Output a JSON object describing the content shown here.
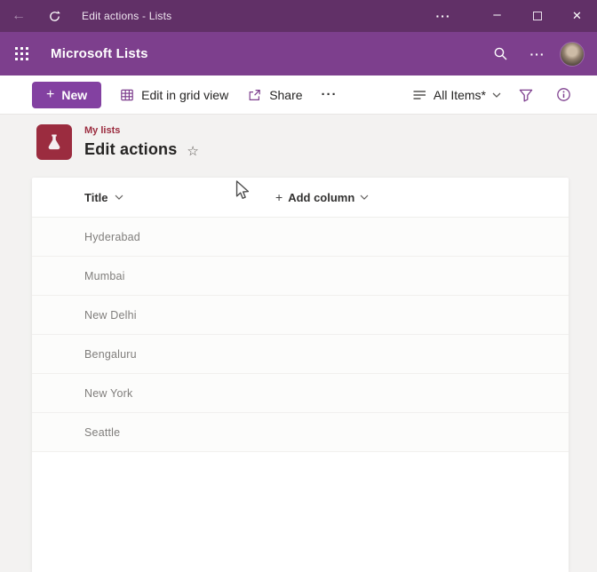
{
  "window": {
    "title": "Edit actions - Lists"
  },
  "app_header": {
    "app_name": "Microsoft Lists"
  },
  "toolbar": {
    "new_label": "New",
    "edit_grid_label": "Edit in grid view",
    "share_label": "Share",
    "view_selected": "All Items*"
  },
  "list_header": {
    "breadcrumb": "My lists",
    "title": "Edit actions"
  },
  "table": {
    "columns": [
      "Title"
    ],
    "add_column_label": "Add column",
    "rows": [
      "Hyderabad",
      "Mumbai",
      "New Delhi",
      "Bengaluru",
      "New York",
      "Seattle"
    ]
  },
  "icons": {
    "back": "←",
    "more": "···",
    "minimize": "–",
    "close": "✕",
    "plus": "+",
    "star": "☆"
  },
  "colors": {
    "titlebar_bg": "#613067",
    "header_bg": "#7d3f8d",
    "accent_purple": "#8341a1",
    "icon_purple": "#7e3f8e",
    "site_red": "#9b2c3f",
    "page_bg": "#f3f2f1"
  }
}
